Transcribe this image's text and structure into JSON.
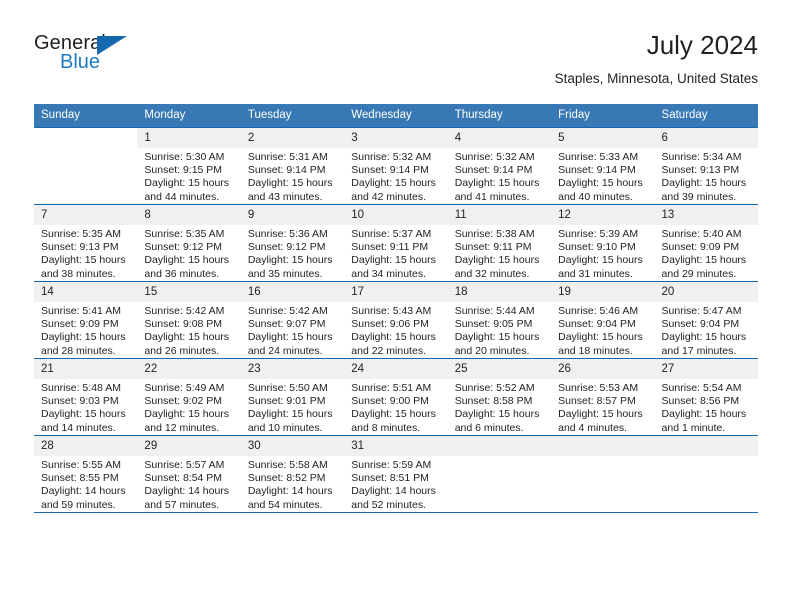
{
  "brand": {
    "name_top": "General",
    "name_bottom": "Blue",
    "triangle_color": "#1567ae",
    "blue_color": "#1f7bc1"
  },
  "header": {
    "title": "July 2024",
    "location": "Staples, Minnesota, United States"
  },
  "theme": {
    "header_bg": "#3878b4",
    "rule_color": "#1567ae",
    "daynum_bg": "#f0f0f0",
    "text_color": "#231f20"
  },
  "weekday_headers": [
    "Sunday",
    "Monday",
    "Tuesday",
    "Wednesday",
    "Thursday",
    "Friday",
    "Saturday"
  ],
  "weeks": [
    [
      {
        "day": "",
        "blank": true,
        "sunrise": "",
        "sunset": "",
        "daylight1": "",
        "daylight2": ""
      },
      {
        "day": "1",
        "sunrise": "Sunrise: 5:30 AM",
        "sunset": "Sunset: 9:15 PM",
        "daylight1": "Daylight: 15 hours",
        "daylight2": "and 44 minutes."
      },
      {
        "day": "2",
        "sunrise": "Sunrise: 5:31 AM",
        "sunset": "Sunset: 9:14 PM",
        "daylight1": "Daylight: 15 hours",
        "daylight2": "and 43 minutes."
      },
      {
        "day": "3",
        "sunrise": "Sunrise: 5:32 AM",
        "sunset": "Sunset: 9:14 PM",
        "daylight1": "Daylight: 15 hours",
        "daylight2": "and 42 minutes."
      },
      {
        "day": "4",
        "sunrise": "Sunrise: 5:32 AM",
        "sunset": "Sunset: 9:14 PM",
        "daylight1": "Daylight: 15 hours",
        "daylight2": "and 41 minutes."
      },
      {
        "day": "5",
        "sunrise": "Sunrise: 5:33 AM",
        "sunset": "Sunset: 9:14 PM",
        "daylight1": "Daylight: 15 hours",
        "daylight2": "and 40 minutes."
      },
      {
        "day": "6",
        "sunrise": "Sunrise: 5:34 AM",
        "sunset": "Sunset: 9:13 PM",
        "daylight1": "Daylight: 15 hours",
        "daylight2": "and 39 minutes."
      }
    ],
    [
      {
        "day": "7",
        "sunrise": "Sunrise: 5:35 AM",
        "sunset": "Sunset: 9:13 PM",
        "daylight1": "Daylight: 15 hours",
        "daylight2": "and 38 minutes."
      },
      {
        "day": "8",
        "sunrise": "Sunrise: 5:35 AM",
        "sunset": "Sunset: 9:12 PM",
        "daylight1": "Daylight: 15 hours",
        "daylight2": "and 36 minutes."
      },
      {
        "day": "9",
        "sunrise": "Sunrise: 5:36 AM",
        "sunset": "Sunset: 9:12 PM",
        "daylight1": "Daylight: 15 hours",
        "daylight2": "and 35 minutes."
      },
      {
        "day": "10",
        "sunrise": "Sunrise: 5:37 AM",
        "sunset": "Sunset: 9:11 PM",
        "daylight1": "Daylight: 15 hours",
        "daylight2": "and 34 minutes."
      },
      {
        "day": "11",
        "sunrise": "Sunrise: 5:38 AM",
        "sunset": "Sunset: 9:11 PM",
        "daylight1": "Daylight: 15 hours",
        "daylight2": "and 32 minutes."
      },
      {
        "day": "12",
        "sunrise": "Sunrise: 5:39 AM",
        "sunset": "Sunset: 9:10 PM",
        "daylight1": "Daylight: 15 hours",
        "daylight2": "and 31 minutes."
      },
      {
        "day": "13",
        "sunrise": "Sunrise: 5:40 AM",
        "sunset": "Sunset: 9:09 PM",
        "daylight1": "Daylight: 15 hours",
        "daylight2": "and 29 minutes."
      }
    ],
    [
      {
        "day": "14",
        "sunrise": "Sunrise: 5:41 AM",
        "sunset": "Sunset: 9:09 PM",
        "daylight1": "Daylight: 15 hours",
        "daylight2": "and 28 minutes."
      },
      {
        "day": "15",
        "sunrise": "Sunrise: 5:42 AM",
        "sunset": "Sunset: 9:08 PM",
        "daylight1": "Daylight: 15 hours",
        "daylight2": "and 26 minutes."
      },
      {
        "day": "16",
        "sunrise": "Sunrise: 5:42 AM",
        "sunset": "Sunset: 9:07 PM",
        "daylight1": "Daylight: 15 hours",
        "daylight2": "and 24 minutes."
      },
      {
        "day": "17",
        "sunrise": "Sunrise: 5:43 AM",
        "sunset": "Sunset: 9:06 PM",
        "daylight1": "Daylight: 15 hours",
        "daylight2": "and 22 minutes."
      },
      {
        "day": "18",
        "sunrise": "Sunrise: 5:44 AM",
        "sunset": "Sunset: 9:05 PM",
        "daylight1": "Daylight: 15 hours",
        "daylight2": "and 20 minutes."
      },
      {
        "day": "19",
        "sunrise": "Sunrise: 5:46 AM",
        "sunset": "Sunset: 9:04 PM",
        "daylight1": "Daylight: 15 hours",
        "daylight2": "and 18 minutes."
      },
      {
        "day": "20",
        "sunrise": "Sunrise: 5:47 AM",
        "sunset": "Sunset: 9:04 PM",
        "daylight1": "Daylight: 15 hours",
        "daylight2": "and 17 minutes."
      }
    ],
    [
      {
        "day": "21",
        "sunrise": "Sunrise: 5:48 AM",
        "sunset": "Sunset: 9:03 PM",
        "daylight1": "Daylight: 15 hours",
        "daylight2": "and 14 minutes."
      },
      {
        "day": "22",
        "sunrise": "Sunrise: 5:49 AM",
        "sunset": "Sunset: 9:02 PM",
        "daylight1": "Daylight: 15 hours",
        "daylight2": "and 12 minutes."
      },
      {
        "day": "23",
        "sunrise": "Sunrise: 5:50 AM",
        "sunset": "Sunset: 9:01 PM",
        "daylight1": "Daylight: 15 hours",
        "daylight2": "and 10 minutes."
      },
      {
        "day": "24",
        "sunrise": "Sunrise: 5:51 AM",
        "sunset": "Sunset: 9:00 PM",
        "daylight1": "Daylight: 15 hours",
        "daylight2": "and 8 minutes."
      },
      {
        "day": "25",
        "sunrise": "Sunrise: 5:52 AM",
        "sunset": "Sunset: 8:58 PM",
        "daylight1": "Daylight: 15 hours",
        "daylight2": "and 6 minutes."
      },
      {
        "day": "26",
        "sunrise": "Sunrise: 5:53 AM",
        "sunset": "Sunset: 8:57 PM",
        "daylight1": "Daylight: 15 hours",
        "daylight2": "and 4 minutes."
      },
      {
        "day": "27",
        "sunrise": "Sunrise: 5:54 AM",
        "sunset": "Sunset: 8:56 PM",
        "daylight1": "Daylight: 15 hours",
        "daylight2": "and 1 minute."
      }
    ],
    [
      {
        "day": "28",
        "sunrise": "Sunrise: 5:55 AM",
        "sunset": "Sunset: 8:55 PM",
        "daylight1": "Daylight: 14 hours",
        "daylight2": "and 59 minutes."
      },
      {
        "day": "29",
        "sunrise": "Sunrise: 5:57 AM",
        "sunset": "Sunset: 8:54 PM",
        "daylight1": "Daylight: 14 hours",
        "daylight2": "and 57 minutes."
      },
      {
        "day": "30",
        "sunrise": "Sunrise: 5:58 AM",
        "sunset": "Sunset: 8:52 PM",
        "daylight1": "Daylight: 14 hours",
        "daylight2": "and 54 minutes."
      },
      {
        "day": "31",
        "sunrise": "Sunrise: 5:59 AM",
        "sunset": "Sunset: 8:51 PM",
        "daylight1": "Daylight: 14 hours",
        "daylight2": "and 52 minutes."
      },
      {
        "day": "",
        "empty": true,
        "sunrise": "",
        "sunset": "",
        "daylight1": "",
        "daylight2": ""
      },
      {
        "day": "",
        "empty": true,
        "sunrise": "",
        "sunset": "",
        "daylight1": "",
        "daylight2": ""
      },
      {
        "day": "",
        "empty": true,
        "sunrise": "",
        "sunset": "",
        "daylight1": "",
        "daylight2": ""
      }
    ]
  ]
}
